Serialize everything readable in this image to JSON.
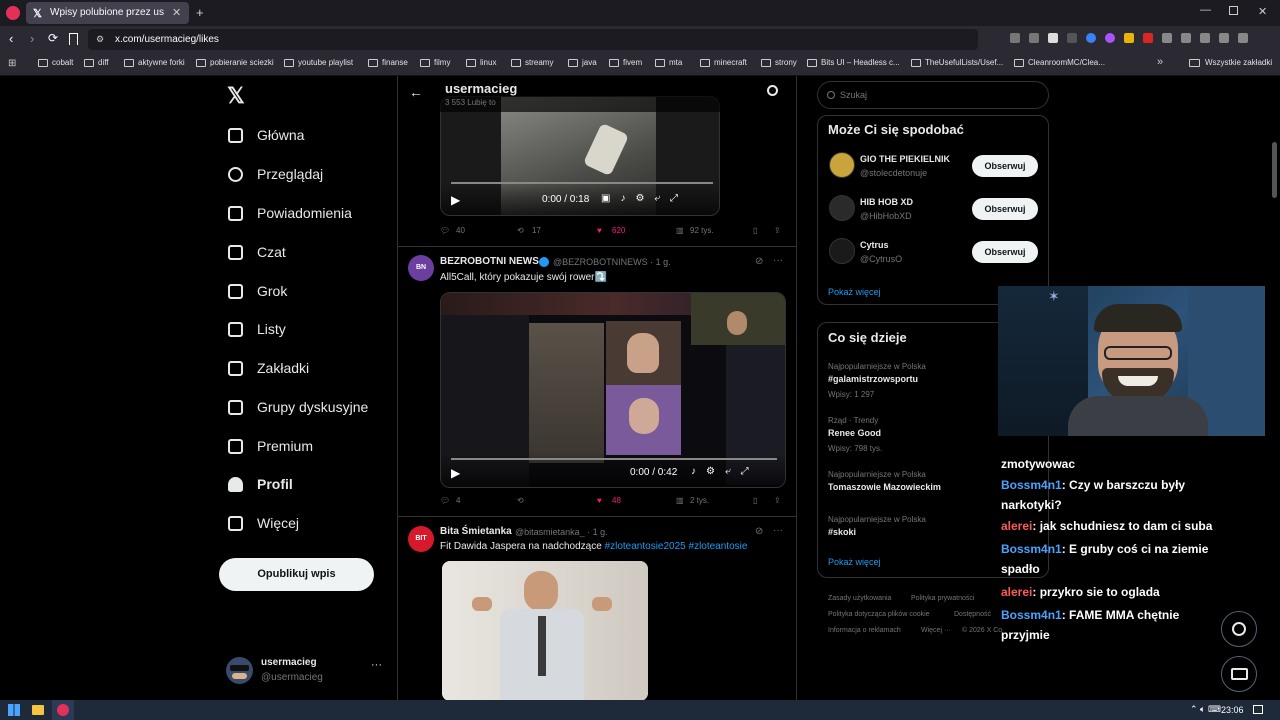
{
  "browser": {
    "tab_title": "Wpisy polubione przez usermac",
    "url": "x.com/usermacieg/likes",
    "bookmarks": [
      "cobalt",
      "diff",
      "aktywne forki",
      "pobieranie sciezki",
      "youtube playlist",
      "finanse",
      "filmy",
      "linux",
      "streamy",
      "java",
      "fivem",
      "mta",
      "minecraft",
      "strony",
      "Bits UI – Headless c...",
      "TheUsefulLists/Usef...",
      "CleanroomMC/Clea..."
    ],
    "all_bookmarks": "Wszystkie zakładki"
  },
  "sidebar": {
    "items": [
      {
        "label": "Główna",
        "icon": "home-icon"
      },
      {
        "label": "Przeglądaj",
        "icon": "search-icon"
      },
      {
        "label": "Powiadomienia",
        "icon": "bell-icon"
      },
      {
        "label": "Czat",
        "icon": "mail-icon"
      },
      {
        "label": "Grok",
        "icon": "grok-icon"
      },
      {
        "label": "Listy",
        "icon": "list-icon"
      },
      {
        "label": "Zakładki",
        "icon": "bookmark-icon"
      },
      {
        "label": "Grupy dyskusyjne",
        "icon": "communities-icon"
      },
      {
        "label": "Premium",
        "icon": "x-icon"
      },
      {
        "label": "Profil",
        "icon": "profile-icon"
      },
      {
        "label": "Więcej",
        "icon": "more-icon"
      }
    ],
    "post_button": "Opublikuj wpis",
    "account_name": "usermacieg",
    "account_handle": "@usermacieg"
  },
  "header": {
    "title": "usermacieg",
    "subtitle": "3 553 Lubię to"
  },
  "tweets": [
    {
      "video_time": "0:00 / 0:18",
      "replies": "40",
      "reposts": "17",
      "likes": "620",
      "views": "92 tys."
    },
    {
      "author": "BEZROBOTNI NEWS",
      "handle": "@BEZROBOTNINEWS · 1 g.",
      "text": "All5Call, który pokazuje swój rower⤵️",
      "video_time": "0:00 / 0:42",
      "replies": "4",
      "reposts": "",
      "likes": "48",
      "views": "2 tys."
    },
    {
      "author": "Bita Śmietanka",
      "handle": "@bitasmietanka_ · 1 g.",
      "text": "Fit Dawida Jaspera na nadchodzące",
      "hashtags": "#zloteantosie2025 #zloteantosie"
    }
  ],
  "right": {
    "search_placeholder": "Szukaj",
    "suggest_title": "Może Ci się spodobać",
    "suggestions": [
      {
        "name": "GIO THE PIEKIELNIK",
        "handle": "@stolecdetonuje",
        "button": "Obserwuj"
      },
      {
        "name": "HIB HOB XD",
        "handle": "@HibHobXD",
        "button": "Obserwuj"
      },
      {
        "name": "Cytrus",
        "handle": "@CytrusO",
        "button": "Obserwuj"
      }
    ],
    "show_more": "Pokaż więcej",
    "trends_title": "Co się dzieje",
    "trends": [
      {
        "meta": "Najpopularniejsze w Polska",
        "name": "#galamistrzowsportu",
        "count": "Wpisy: 1 297"
      },
      {
        "meta": "Rząd · Trendy",
        "name": "Renee Good",
        "count": "Wpisy: 798 tys."
      },
      {
        "meta": "Najpopularniejsze w Polska",
        "name": "Tomaszowie Mazowieckim",
        "count": ""
      },
      {
        "meta": "Najpopularniejsze w Polska",
        "name": "#skoki",
        "count": ""
      }
    ],
    "trends_more": "Pokaż więcej",
    "footer": [
      "Zasady użytkowania",
      "Polityka prywatności",
      "Polityka dotycząca plików cookie",
      "Dostępność",
      "Informacja o reklamach",
      "Więcej ···",
      "© 2026 X Co"
    ]
  },
  "chat": {
    "lines": [
      {
        "user": "",
        "text": "zmotywowac",
        "color": "none"
      },
      {
        "user": "Bossm4n1",
        "text": "Czy w barszczu były",
        "color": "blue"
      },
      {
        "user": "",
        "text": "narkotyki?",
        "color": "none"
      },
      {
        "user": "alerei",
        "text": "jak schudniesz to dam ci suba",
        "color": "red"
      },
      {
        "user": "Bossm4n1",
        "text": "E gruby coś ci na ziemie",
        "color": "blue"
      },
      {
        "user": "",
        "text": "spadło",
        "color": "none"
      },
      {
        "user": "alerei",
        "text": "przykro sie to oglada",
        "color": "red"
      },
      {
        "user": "Bossm4n1",
        "text": "FAME MMA chętnie",
        "color": "blue"
      },
      {
        "user": "",
        "text": "przyjmie",
        "color": "none"
      }
    ]
  },
  "taskbar": {
    "time": "23:06"
  }
}
